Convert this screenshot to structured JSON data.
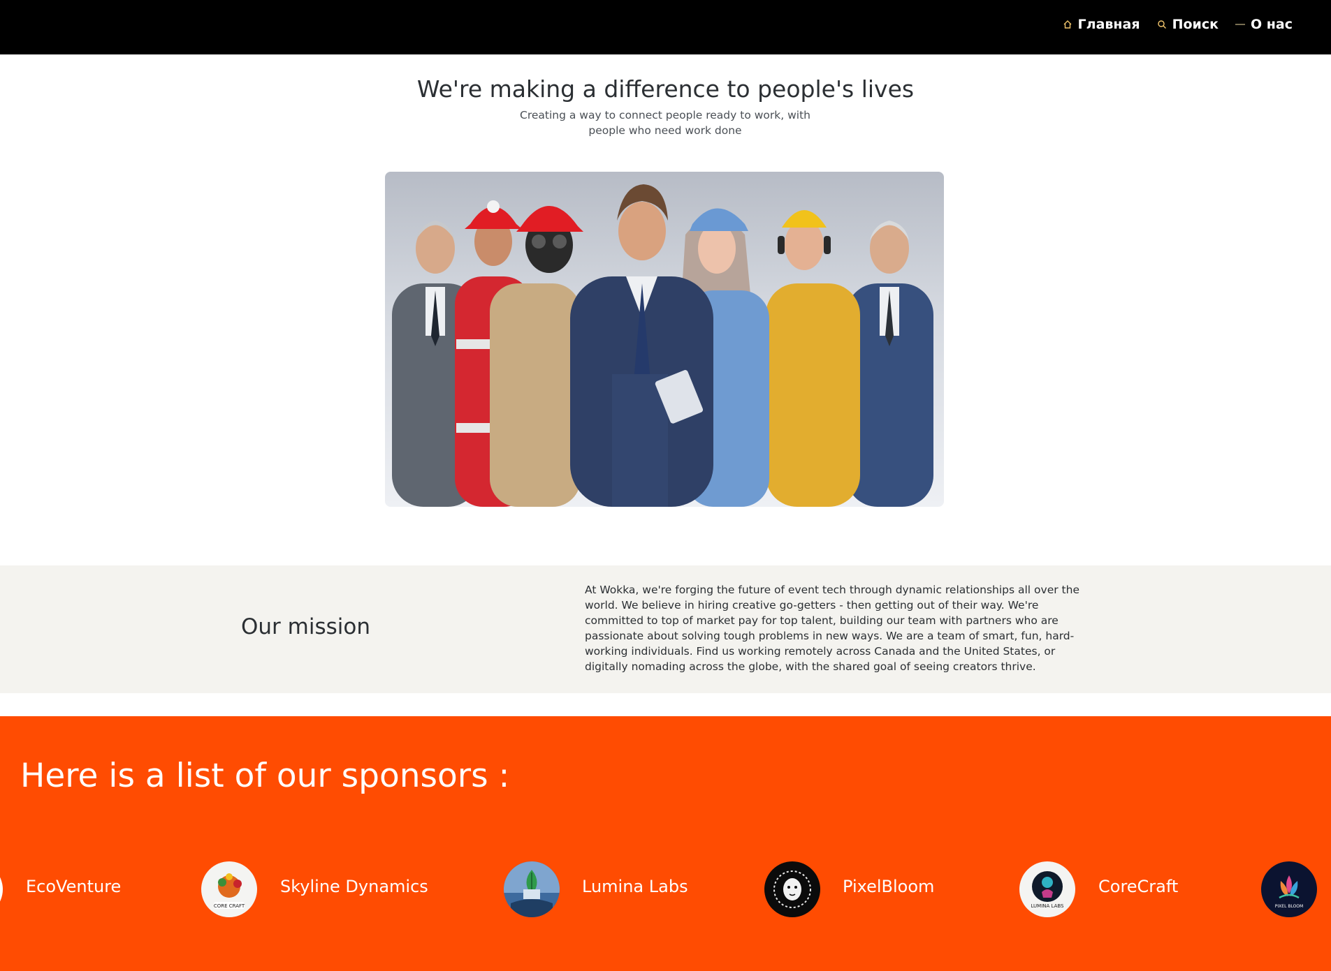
{
  "nav": {
    "items": [
      {
        "label": "Главная",
        "icon": "home-icon"
      },
      {
        "label": "Поиск",
        "icon": "search-icon"
      },
      {
        "label": "О нас",
        "icon": "about-icon"
      }
    ]
  },
  "hero": {
    "title": "We're making a difference to people's lives",
    "subtitle": "Creating a way to connect people ready to work, with people who need work done"
  },
  "mission": {
    "title": "Our mission",
    "text": "At Wokka, we're forging the future of event tech through dynamic relationships all over the world. We believe in hiring creative go-getters - then getting out of their way. We're committed to top of market pay for top talent, building our team with partners who are passionate about solving tough problems in new ways. We are a team of smart, fun, hard-working individuals. Find us working remotely across Canada and the United States, or digitally nomading across the globe, with the shared goal of seeing creators thrive."
  },
  "sponsors": {
    "title": "Here is a list of our sponsors :",
    "items": [
      {
        "name": "EcoVenture"
      },
      {
        "name": "Skyline Dynamics"
      },
      {
        "name": "Lumina Labs"
      },
      {
        "name": "PixelBloom"
      },
      {
        "name": "CoreCraft"
      }
    ],
    "logo_text": {
      "corecraft": "CORE CRAFT",
      "lumina": "LUMINA LABS",
      "pixelbloom": "PIXEL BLOOM"
    }
  },
  "colors": {
    "nav_bg": "#000000",
    "accent": "#ff4c02",
    "mission_bg": "#f4f3ef",
    "icon_gold": "#f2c66d"
  }
}
